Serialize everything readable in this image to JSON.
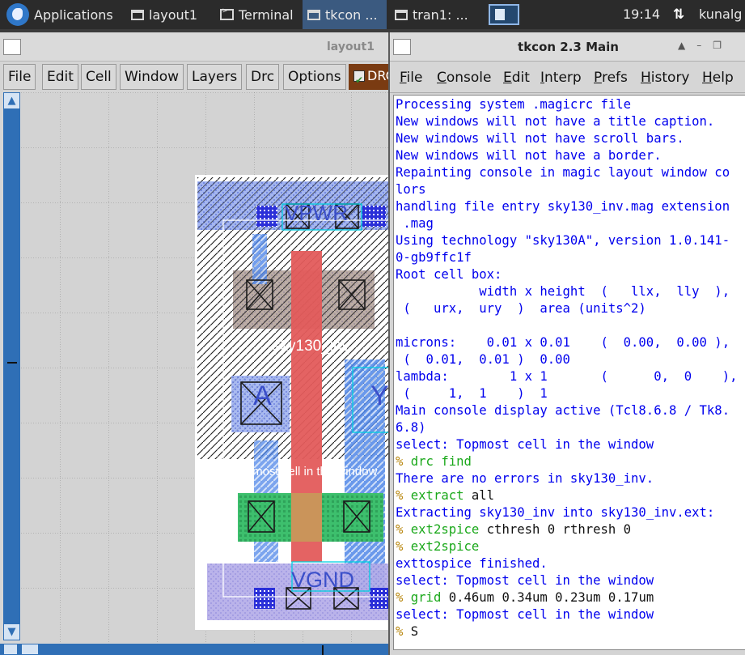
{
  "taskbar": {
    "apps_label": "Applications",
    "tasks": [
      {
        "label": "layout1",
        "icon": "window-icon",
        "active": false
      },
      {
        "label": "Terminal",
        "icon": "terminal-icon",
        "active": false
      },
      {
        "label": "tkcon ...",
        "icon": "window-icon",
        "active": true
      },
      {
        "label": "tran1: ...",
        "icon": "window-icon",
        "active": false
      }
    ],
    "clock": "19:14",
    "user": "kunalg"
  },
  "layout_window": {
    "title": "layout1",
    "menu": [
      "File",
      "Edit",
      "Cell",
      "Window",
      "Layers",
      "Drc",
      "Options"
    ],
    "drc_toggle_label": "DRC",
    "labels": {
      "vpwr": "VPWR",
      "cell": "sky130_inv",
      "a": "A",
      "y": "Y",
      "topmost": "Topmost cell in the window",
      "vgnd": "VGND"
    }
  },
  "tkcon": {
    "title": "tkcon 2.3 Main",
    "menu": [
      "File",
      "Console",
      "Edit",
      "Interp",
      "Prefs",
      "History",
      "Help"
    ],
    "lines": [
      {
        "text": "Processing system .magicrc file"
      },
      {
        "text": "New windows will not have a title caption."
      },
      {
        "text": "New windows will not have scroll bars."
      },
      {
        "text": "New windows will not have a border."
      },
      {
        "text": "Repainting console in magic layout window co"
      },
      {
        "text": "lors"
      },
      {
        "text": "handling file entry sky130_inv.mag extension"
      },
      {
        "text": " .mag"
      },
      {
        "text": "Using technology \"sky130A\", version 1.0.141-"
      },
      {
        "text": "0-gb9ffc1f"
      },
      {
        "text": "Root cell box:"
      },
      {
        "text": "           width x height  (   llx,  lly  ),"
      },
      {
        "text": " (   urx,  ury  )  area (units^2)"
      },
      {
        "text": ""
      },
      {
        "text": "microns:    0.01 x 0.01    (  0.00,  0.00 ),"
      },
      {
        "text": " (  0.01,  0.01 )  0.00"
      },
      {
        "text": "lambda:        1 x 1       (      0,  0    ),"
      },
      {
        "text": " (     1,  1    )  1"
      },
      {
        "text": "Main console display active (Tcl8.6.8 / Tk8."
      },
      {
        "text": "6.8)"
      },
      {
        "text": "select: Topmost cell in the window"
      },
      {
        "cmd": "drc find",
        "args": ""
      },
      {
        "text": "There are no errors in sky130_inv."
      },
      {
        "cmd": "extract",
        "args": "all"
      },
      {
        "text": "Extracting sky130_inv into sky130_inv.ext:"
      },
      {
        "cmd": "ext2spice",
        "args": "cthresh 0 rthresh 0"
      },
      {
        "cmd": "ext2spice",
        "args": ""
      },
      {
        "text": "exttospice finished."
      },
      {
        "text": "select: Topmost cell in the window"
      },
      {
        "cmd": "grid",
        "args": "0.46um 0.34um 0.23um 0.17um"
      },
      {
        "text": "select: Topmost cell in the window"
      },
      {
        "cmd": "",
        "args": "S"
      }
    ]
  }
}
